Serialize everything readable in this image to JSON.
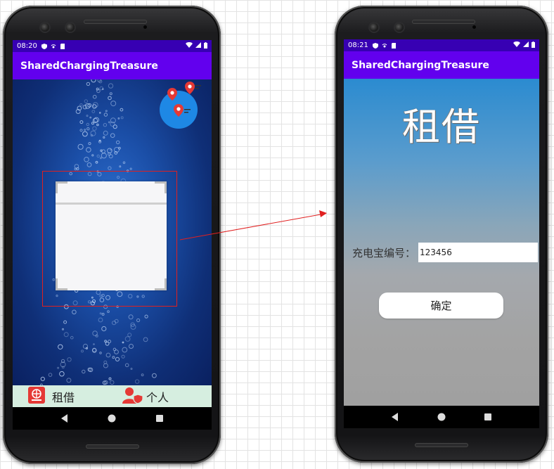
{
  "left_phone": {
    "status": {
      "time": "08:20"
    },
    "appbar": {
      "title": "SharedChargingTreasure"
    },
    "tabs": [
      {
        "label": "租借",
        "icon": "rent-icon"
      },
      {
        "label": "个人",
        "icon": "person-shield-icon"
      }
    ],
    "nav": [
      "back-icon",
      "home-icon",
      "recents-icon"
    ]
  },
  "right_phone": {
    "status": {
      "time": "08:21"
    },
    "appbar": {
      "title": "SharedChargingTreasure"
    },
    "page_title": "租借",
    "field_label": "充电宝编号：",
    "field_value": "123456",
    "confirm_label": "确定",
    "nav": [
      "back-icon",
      "home-icon",
      "recents-icon"
    ]
  },
  "annotation": {
    "color": "#e02020"
  },
  "colors": {
    "statusbar": "#3700b3",
    "appbar": "#6200ee",
    "tabbar": "#d6eee0",
    "map_marker": "#e53935",
    "map_circle": "#1e88e5"
  }
}
